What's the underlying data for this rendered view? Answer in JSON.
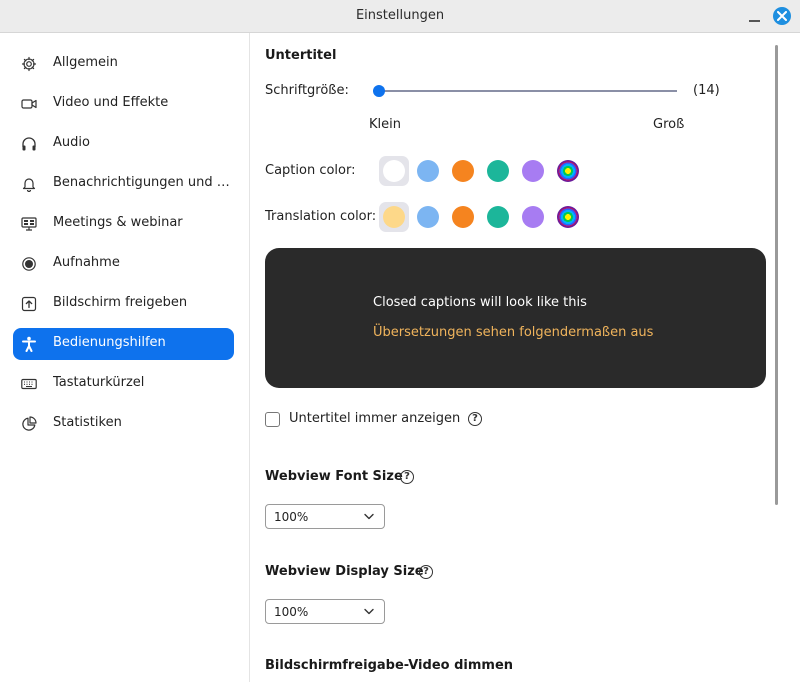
{
  "window": {
    "title": "Einstellungen"
  },
  "sidebar": {
    "items": [
      {
        "label": "Allgemein",
        "icon": "gear-icon",
        "active": false
      },
      {
        "label": "Video und Effekte",
        "icon": "video-camera-icon",
        "active": false
      },
      {
        "label": "Audio",
        "icon": "headphones-icon",
        "active": false
      },
      {
        "label": "Benachrichtigungen und So...",
        "icon": "bell-icon",
        "active": false
      },
      {
        "label": "Meetings & webinar",
        "icon": "meetings-icon",
        "active": false
      },
      {
        "label": "Aufnahme",
        "icon": "record-icon",
        "active": false
      },
      {
        "label": "Bildschirm freigeben",
        "icon": "share-screen-icon",
        "active": false
      },
      {
        "label": "Bedienungshilfen",
        "icon": "accessibility-icon",
        "active": true
      },
      {
        "label": "Tastaturkürzel",
        "icon": "keyboard-icon",
        "active": false
      },
      {
        "label": "Statistiken",
        "icon": "pie-chart-icon",
        "active": false
      }
    ]
  },
  "main": {
    "subtitles": {
      "title": "Untertitel",
      "font_size_label": "Schriftgröße:",
      "font_size_value": "(14)",
      "font_size_slider_fraction": 0.0,
      "min_label": "Klein",
      "max_label": "Groß",
      "caption_color_label": "Caption color:",
      "translation_color_label": "Translation color:",
      "caption_colors": [
        "#ffffff",
        "#7cb5f2",
        "#f5841f",
        "#1cb69a",
        "#a77cf2",
        "rainbow"
      ],
      "caption_selected_index": 0,
      "translation_colors": [
        "#fdd889",
        "#7cb5f2",
        "#f5841f",
        "#1cb69a",
        "#a77cf2",
        "rainbow"
      ],
      "translation_selected_index": 0,
      "preview_line1": "Closed captions will look like this",
      "preview_line2": "Übersetzungen sehen folgendermaßen aus",
      "always_show_label": "Untertitel immer anzeigen",
      "always_show_checked": false
    },
    "webview_font": {
      "title": "Webview Font Size",
      "value": "100%"
    },
    "webview_display": {
      "title": "Webview Display Size",
      "value": "100%"
    },
    "dim_video": {
      "title": "Bildschirmfreigabe-Video dimmen"
    }
  },
  "colors": {
    "accent": "#0e72ed",
    "preview_bg": "#2a2a2a",
    "translation_text": "#f0b45c"
  }
}
